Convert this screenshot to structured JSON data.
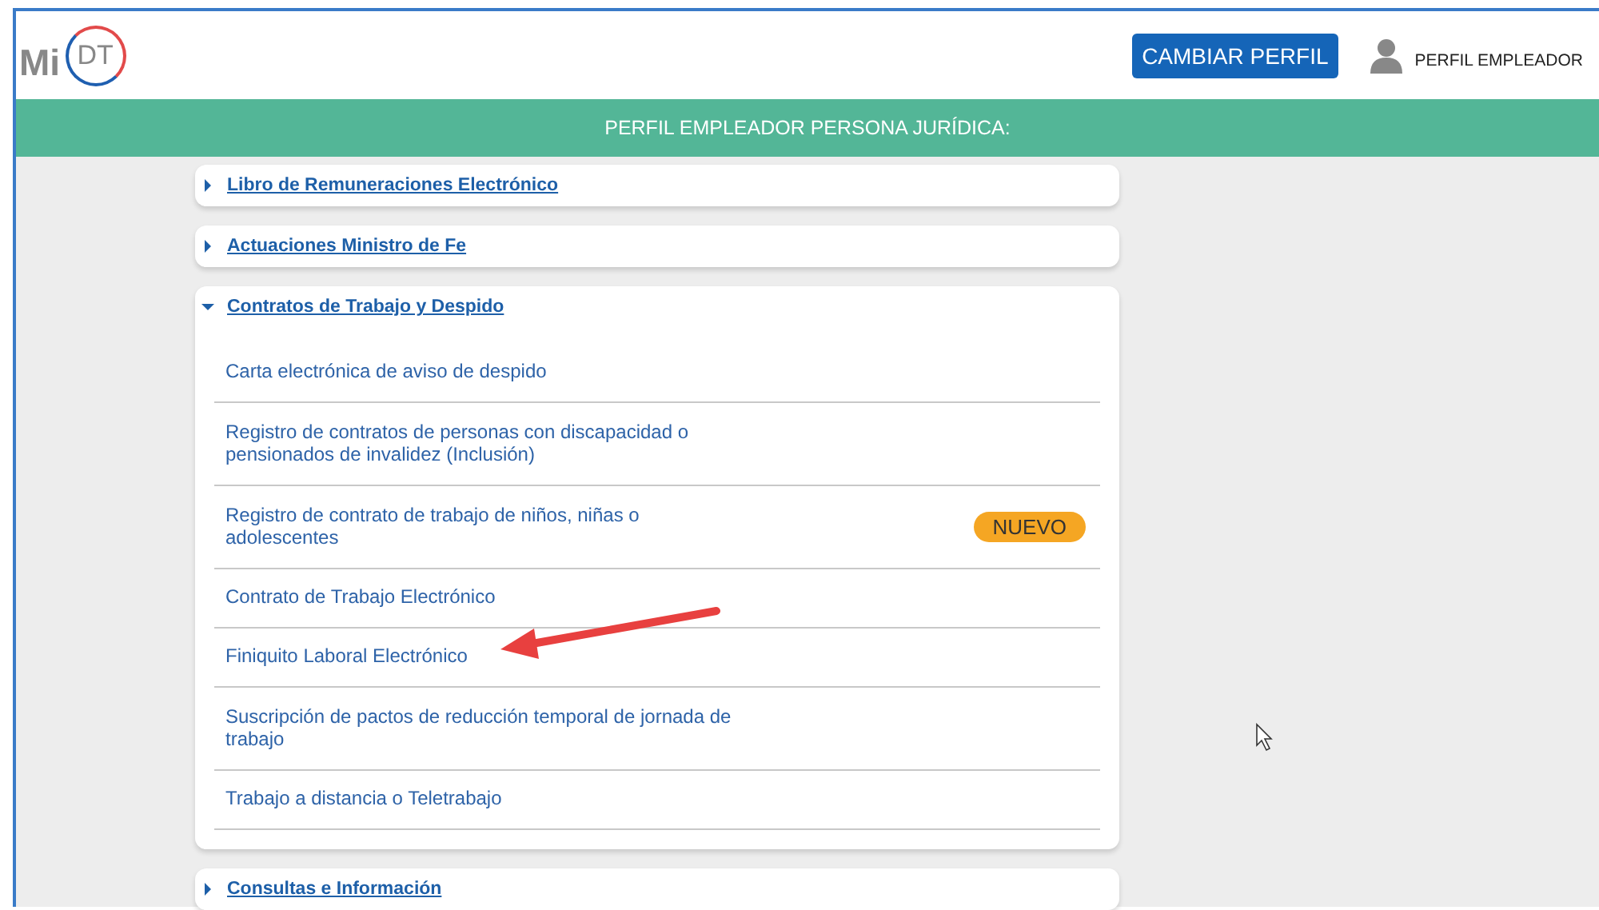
{
  "header": {
    "logo_prefix": "Mi",
    "logo_badge": "DT",
    "change_profile_button": "CAMBIAR PERFIL",
    "user_label": "PERFIL EMPLEADOR"
  },
  "banner": "PERFIL EMPLEADOR PERSONA JURÍDICA:",
  "sections": [
    {
      "title": "Libro de Remuneraciones Electrónico",
      "expanded": false
    },
    {
      "title": "Actuaciones Ministro de Fe",
      "expanded": false
    },
    {
      "title": "Contratos de Trabajo y Despido",
      "expanded": true,
      "items": [
        {
          "label": "Carta electrónica de aviso de despido"
        },
        {
          "label": "Registro de contratos de personas con discapacidad o pensionados de invalidez (Inclusión)"
        },
        {
          "label": "Registro de contrato de trabajo de niños, niñas o adolescentes",
          "badge": "NUEVO"
        },
        {
          "label": "Contrato de Trabajo Electrónico"
        },
        {
          "label": "Finiquito Laboral Electrónico"
        },
        {
          "label": "Suscripción de pactos de reducción temporal de jornada de trabajo"
        },
        {
          "label": "Trabajo a distancia o Teletrabajo"
        }
      ]
    },
    {
      "title": "Consultas e Información",
      "expanded": false
    }
  ]
}
